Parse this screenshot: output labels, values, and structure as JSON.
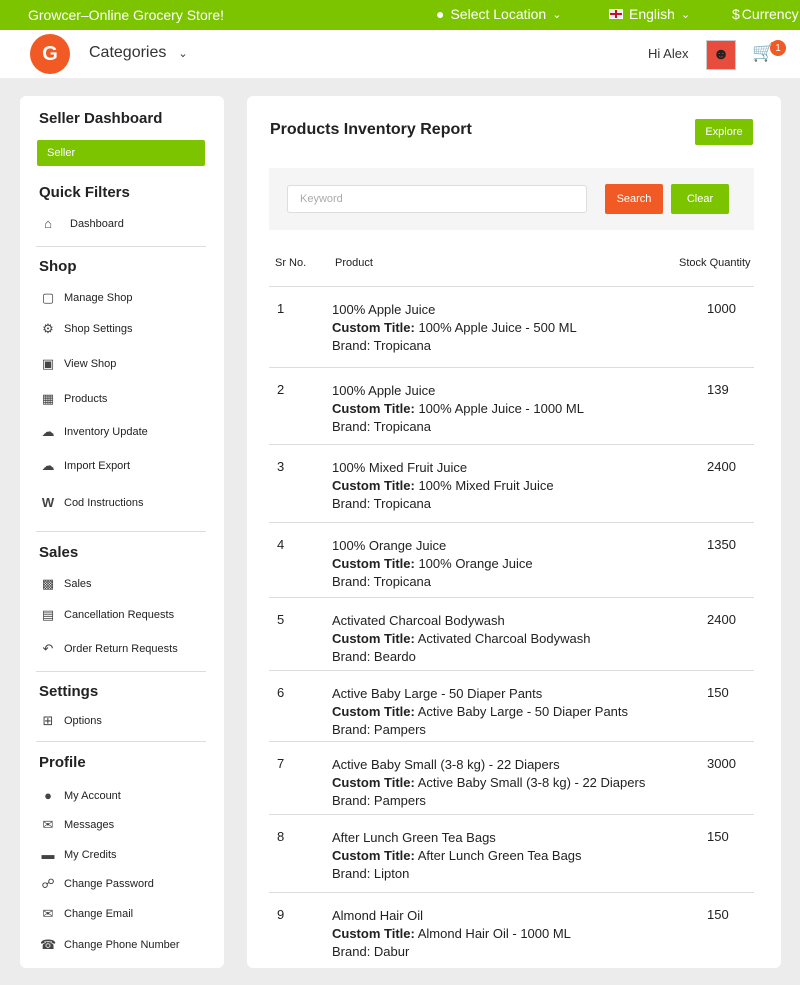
{
  "topbar": {
    "store_name": "Growcer–Online Grocery Store!",
    "location_label": "Select Location",
    "language_label": "English",
    "currency_label": "Currency"
  },
  "header": {
    "categories_label": "Categories",
    "greeting": "Hi Alex",
    "cart_count": "1"
  },
  "sidebar": {
    "dashboard_title": "Seller Dashboard",
    "seller_label": "Seller",
    "quick_filters_title": "Quick Filters",
    "dashboard_item": "Dashboard",
    "shop_title": "Shop",
    "shop_items": [
      "Manage Shop",
      "Shop Settings",
      "View Shop",
      "Products",
      "Inventory Update",
      "Import Export",
      "Cod Instructions"
    ],
    "sales_title": "Sales",
    "sales_items": [
      "Sales",
      "Cancellation Requests",
      "Order Return Requests"
    ],
    "settings_title": "Settings",
    "settings_items": [
      "Options"
    ],
    "profile_title": "Profile",
    "profile_items": [
      "My Account",
      "Messages",
      "My Credits",
      "Change Password",
      "Change Email",
      "Change Phone Number"
    ]
  },
  "main": {
    "title": "Products Inventory Report",
    "explore_label": "Explore",
    "keyword_placeholder": "Keyword",
    "search_label": "Search",
    "clear_label": "Clear",
    "columns": {
      "sr": "Sr No.",
      "product": "Product",
      "qty": "Stock Quantity"
    },
    "custom_title_label": "Custom Title:",
    "rows": [
      {
        "sr": "1",
        "name": "100% Apple Juice",
        "custom": "100% Apple Juice - 500 ML",
        "brand": "Brand: Tropicana",
        "qty": "1000"
      },
      {
        "sr": "2",
        "name": "100% Apple Juice",
        "custom": "100% Apple Juice - 1000 ML",
        "brand": "Brand: Tropicana",
        "qty": "139"
      },
      {
        "sr": "3",
        "name": "100% Mixed Fruit Juice",
        "custom": "100% Mixed Fruit Juice",
        "brand": "Brand: Tropicana",
        "qty": "2400"
      },
      {
        "sr": "4",
        "name": "100% Orange Juice",
        "custom": "100% Orange Juice",
        "brand": "Brand: Tropicana",
        "qty": "1350"
      },
      {
        "sr": "5",
        "name": "Activated Charcoal Bodywash",
        "custom": "Activated Charcoal Bodywash",
        "brand": "Brand: Beardo",
        "qty": "2400"
      },
      {
        "sr": "6",
        "name": "Active Baby Large - 50 Diaper Pants",
        "custom": "Active Baby Large - 50 Diaper Pants",
        "brand": "Brand: Pampers",
        "qty": "150"
      },
      {
        "sr": "7",
        "name": "Active Baby Small (3-8 kg) - 22 Diapers",
        "custom": "Active Baby Small (3-8 kg) - 22 Diapers",
        "brand": "Brand: Pampers",
        "qty": "3000"
      },
      {
        "sr": "8",
        "name": "After Lunch Green Tea Bags",
        "custom": "After Lunch Green Tea Bags",
        "brand": "Brand: Lipton",
        "qty": "150"
      },
      {
        "sr": "9",
        "name": "Almond Hair Oil",
        "custom": "Almond Hair Oil - 1000 ML",
        "brand": "Brand: Dabur",
        "qty": "150"
      }
    ]
  },
  "colors": {
    "primary_green": "#7dc400",
    "accent_orange": "#f15a24"
  }
}
